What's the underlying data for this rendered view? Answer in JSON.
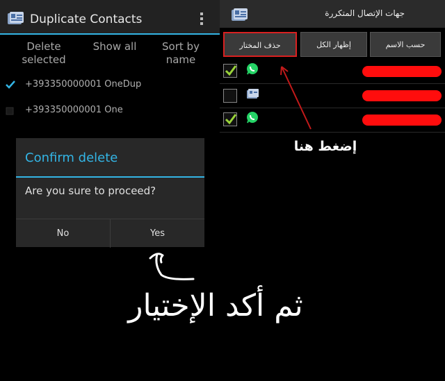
{
  "left": {
    "app_title": "Duplicate Contacts",
    "columns": [
      "Delete selected",
      "Show all",
      "Sort by name"
    ],
    "contacts": [
      {
        "number": "+393350000001 OneDup",
        "checked": true
      },
      {
        "number": "+393350000001 One",
        "checked": false
      }
    ],
    "dialog": {
      "title": "Confirm delete",
      "message": "Are you sure to proceed?",
      "no_label": "No",
      "yes_label": "Yes"
    },
    "instruction": "ثم أكد الإختيار"
  },
  "right": {
    "app_title": "جهات الإتصال المتكررة",
    "buttons": {
      "sort_by_name": "حسب الاسم",
      "show_all": "إظهار الكل",
      "delete_selected": "حذف المختار"
    },
    "rows": [
      {
        "checked": true,
        "icon": "whatsapp-icon"
      },
      {
        "checked": false,
        "icon": "contacts-app-icon"
      },
      {
        "checked": true,
        "icon": "whatsapp-icon"
      }
    ],
    "hint": "إضغط هنا"
  },
  "colors": {
    "accent": "#33b5e5",
    "redaction": "#ff0d0d",
    "highlight": "#d92020",
    "whatsapp": "#25d366"
  }
}
